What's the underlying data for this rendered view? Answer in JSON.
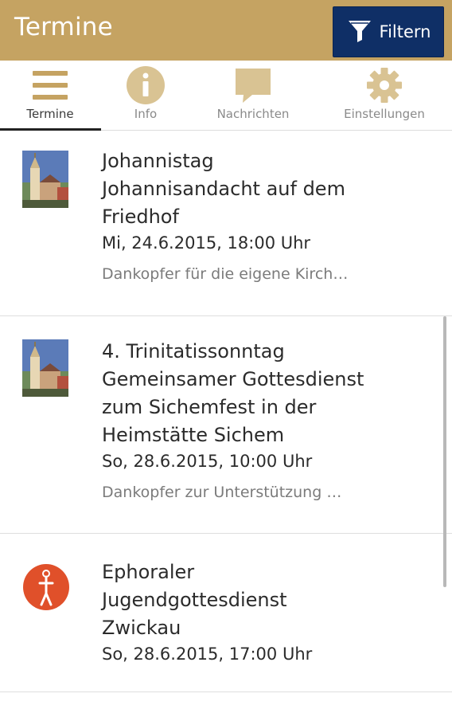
{
  "appbar": {
    "title": "Termine",
    "filter_label": "Filtern",
    "background_color": "#c5a362",
    "button_color": "#0f2f66"
  },
  "tabs": [
    {
      "label": "Termine",
      "icon": "list-icon",
      "active": true
    },
    {
      "label": "Info",
      "icon": "info-icon",
      "active": false
    },
    {
      "label": "Nachrichten",
      "icon": "chat-bubble-icon",
      "active": false
    },
    {
      "label": "Einstellungen",
      "icon": "gear-icon",
      "active": false
    }
  ],
  "events": [
    {
      "title_line1": "Johannistag",
      "title_line2": "Johannisandacht auf dem",
      "title_line3": "Friedhof",
      "date": "Mi, 24.6.2015, 18:00 Uhr",
      "description": "Dankopfer für die eigene Kirch…",
      "image": "church-tower-photo"
    },
    {
      "title_line1": "4. Trinitatissonntag",
      "title_line2": "Gemeinsamer Gottesdienst",
      "title_line3": "zum Sichemfest in der",
      "title_line4": "Heimstätte Sichem",
      "date": "So, 28.6.2015, 10:00 Uhr",
      "description": "Dankopfer zur Unterstützung …",
      "image": "church-tower-photo"
    },
    {
      "title_line1": "Ephoraler",
      "title_line2": "Jugendgottesdienst",
      "title_line3": "Zwickau",
      "date": "So, 28.6.2015, 17:00 Uhr",
      "image": "youth-logo"
    }
  ]
}
